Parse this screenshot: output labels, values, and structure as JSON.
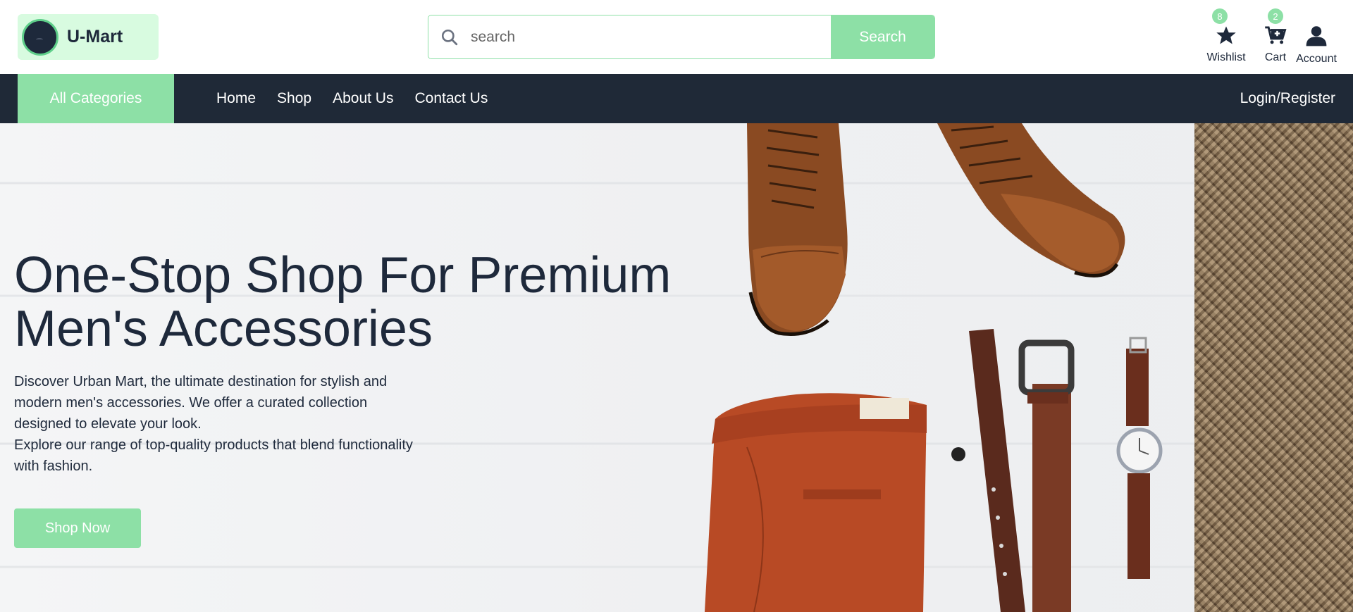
{
  "brand": {
    "name": "U-Mart"
  },
  "search": {
    "placeholder": "search",
    "button_label": "Search"
  },
  "header_actions": {
    "wishlist": {
      "label": "Wishlist",
      "count": "8",
      "icon": "star-icon"
    },
    "cart": {
      "label": "Cart",
      "count": "2",
      "icon": "cart-plus-icon"
    },
    "account": {
      "label": "Account",
      "icon": "user-icon"
    }
  },
  "nav": {
    "categories_label": "All Categories",
    "links": [
      "Home",
      "Shop",
      "About Us",
      "Contact Us"
    ],
    "login_label": "Login/Register"
  },
  "hero": {
    "title_line1": "One-Stop Shop For Premium",
    "title_line2": "Men's Accessories",
    "desc_line1": "Discover Urban Mart, the ultimate destination for stylish and",
    "desc_line2": "modern men's accessories. We offer a curated collection",
    "desc_line3": "designed to elevate your look.",
    "desc_line4": "Explore our range of top-quality products that blend functionality",
    "desc_line5": "with fashion.",
    "cta_label": "Shop Now"
  },
  "colors": {
    "accent": "#8de0a6",
    "accent_light": "#d8fbe0",
    "dark": "#1f2937",
    "text": "#1e293b"
  }
}
